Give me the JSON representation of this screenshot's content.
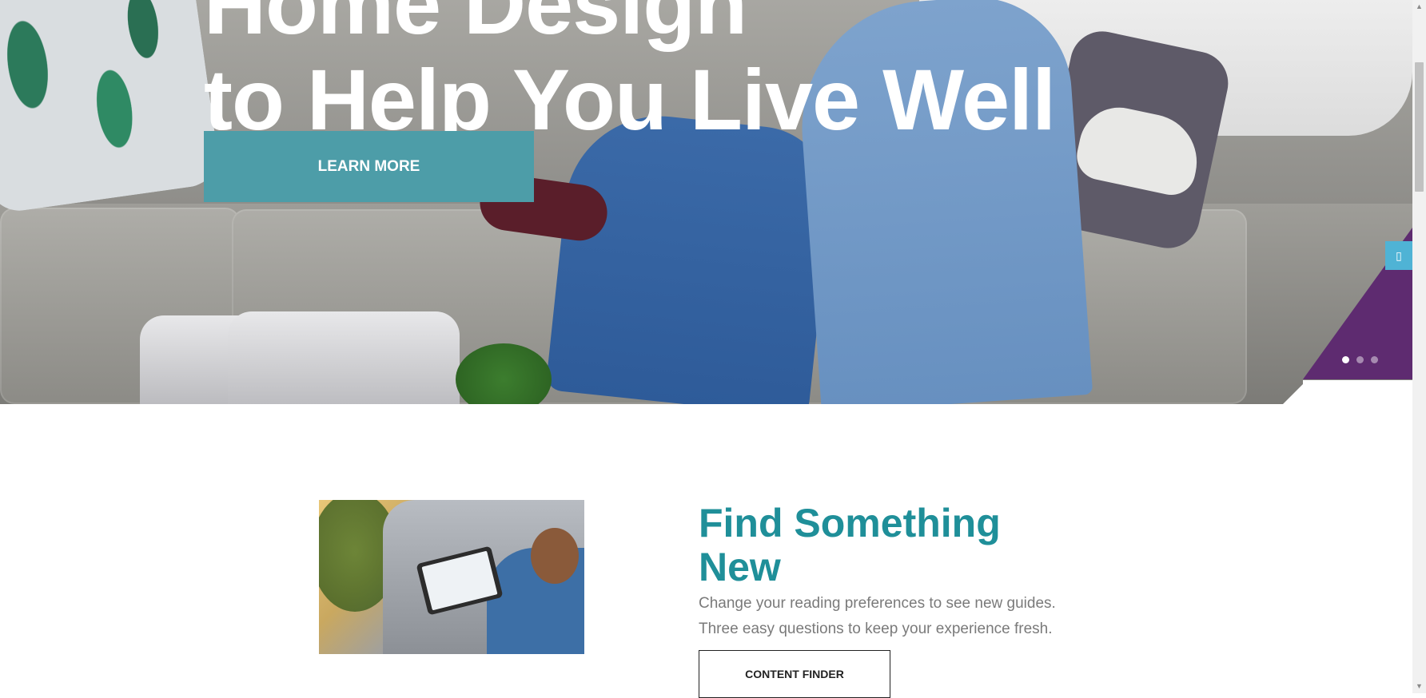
{
  "hero": {
    "title_line1": "Home Design",
    "title_line2": "to Help You Live Well",
    "button_label": "LEARN MORE",
    "side_tab_icon": "phone-icon",
    "slides": 3,
    "active_slide": 1
  },
  "section": {
    "image_alt": "man-using-tablet-on-couch",
    "title_line1": "Find Something",
    "title_line2": "New",
    "text_line1": "Change your reading preferences to see new guides.",
    "text_line2": "Three easy questions to keep your experience fresh.",
    "button_label": "CONTENT FINDER"
  },
  "colors": {
    "accent_teal": "#4d9da8",
    "title_teal": "#1f8f99",
    "purple": "#5e2b70",
    "side_tab_blue": "#4fb3d5"
  }
}
